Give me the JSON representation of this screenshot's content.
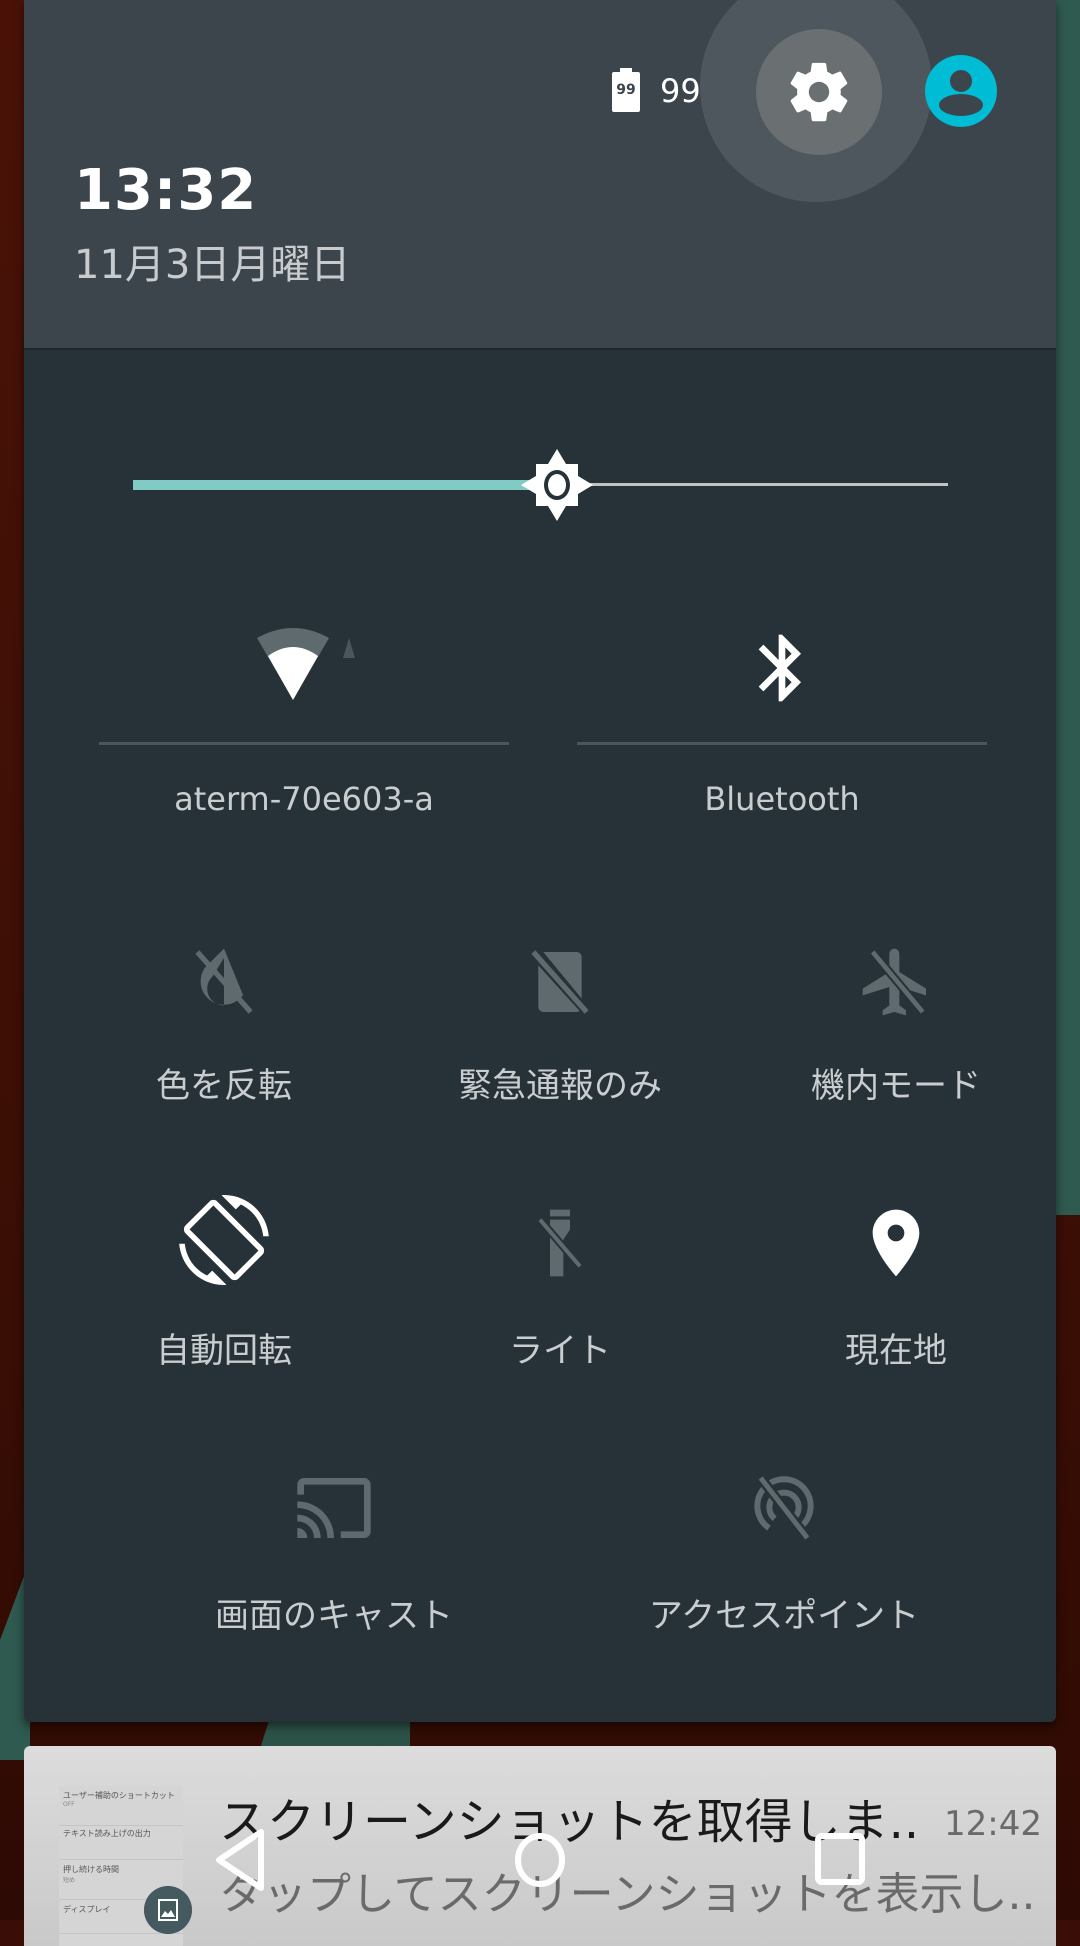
{
  "status": {
    "battery_icon_digits": "99",
    "battery_percent": "99%"
  },
  "header": {
    "time": "13:32",
    "date": "11月3日月曜日",
    "settings_icon": "gear-icon",
    "user_icon": "account-circle-icon",
    "accent_color": "#00bcd4"
  },
  "brightness": {
    "level_fraction": 0.52,
    "fill_color": "#80cbc4"
  },
  "tiles_large": [
    {
      "label": "aterm-70e603-a",
      "icon": "wifi-icon",
      "state": "on"
    },
    {
      "label": "Bluetooth",
      "icon": "bluetooth-icon",
      "state": "on"
    }
  ],
  "tiles": [
    {
      "label": "色を反転",
      "icon": "invert-colors-off-icon",
      "state": "off"
    },
    {
      "label": "緊急通報のみ",
      "icon": "no-sim-icon",
      "state": "off"
    },
    {
      "label": "機内モード",
      "icon": "airplane-off-icon",
      "state": "off"
    },
    {
      "label": "自動回転",
      "icon": "screen-rotation-icon",
      "state": "on"
    },
    {
      "label": "ライト",
      "icon": "flashlight-off-icon",
      "state": "off"
    },
    {
      "label": "現在地",
      "icon": "location-pin-icon",
      "state": "on"
    },
    {
      "label": "画面のキャスト",
      "icon": "cast-icon",
      "state": "off"
    },
    {
      "label": "アクセスポイント",
      "icon": "hotspot-off-icon",
      "state": "off"
    }
  ],
  "notification": {
    "title": "スクリーンショットを取得しま..",
    "text": "タップしてスクリーンショットを表示し..",
    "time": "12:42",
    "thumbnail_rows": [
      {
        "title": "ユーザー補助のショートカット",
        "sub": "OFF"
      },
      {
        "title": "テキスト読み上げの出力",
        "sub": ""
      },
      {
        "title": "押し続ける時間",
        "sub": "短め"
      },
      {
        "title": "ディスプレイ",
        "sub": ""
      }
    ]
  },
  "navbar": {
    "back": "back-icon",
    "home": "home-icon",
    "recents": "recents-icon"
  }
}
